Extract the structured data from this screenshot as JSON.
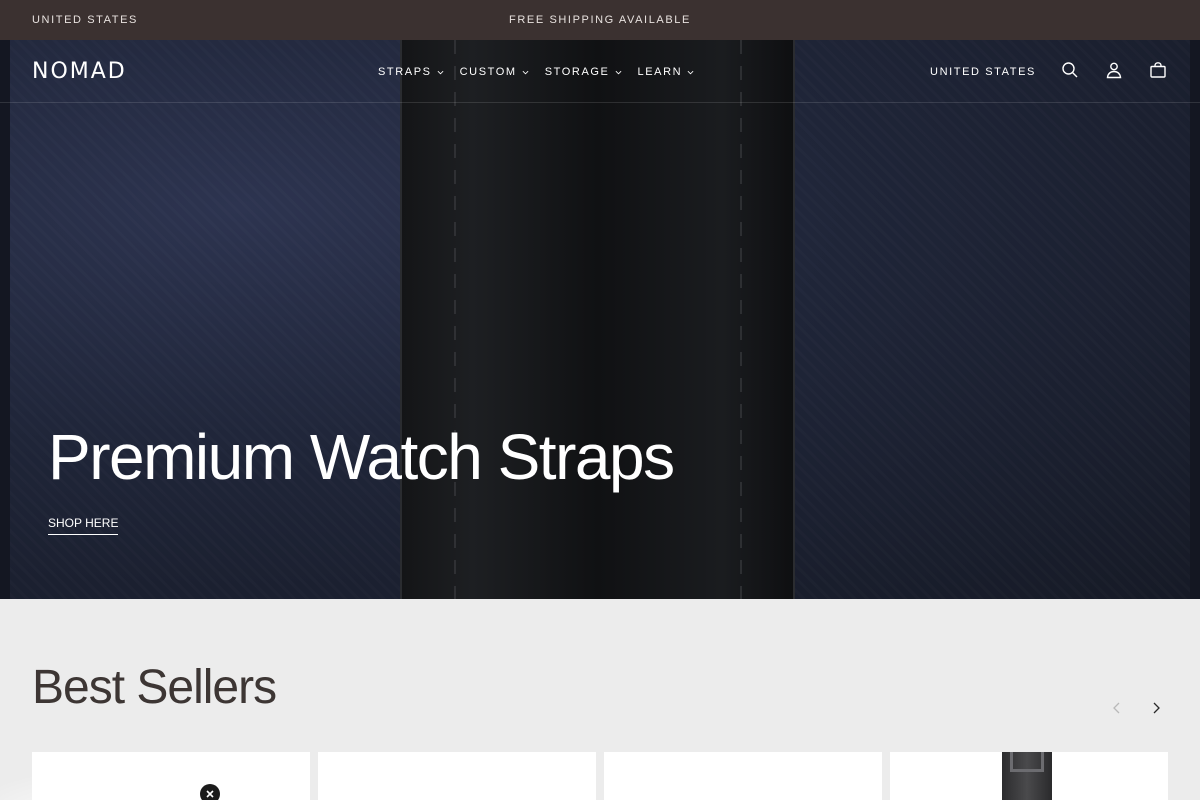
{
  "announcement": {
    "region": "UNITED STATES",
    "message": "FREE SHIPPING AVAILABLE"
  },
  "nav": {
    "logo": "NOMAD",
    "menu": [
      {
        "label": "STRAPS"
      },
      {
        "label": "CUSTOM"
      },
      {
        "label": "STORAGE"
      },
      {
        "label": "LEARN"
      }
    ],
    "region": "UNITED STATES",
    "icons": [
      "search-icon",
      "account-icon",
      "cart-icon"
    ]
  },
  "hero": {
    "title": "Premium Watch Straps",
    "link": "SHOP HERE"
  },
  "best_sellers": {
    "title": "Best Sellers",
    "icons": [
      "chevron-left-icon",
      "chevron-right-icon"
    ]
  },
  "colors": {
    "announcement_bg": "#3b3130",
    "section_bg": "#ececec",
    "heading_text": "#3d3634"
  }
}
